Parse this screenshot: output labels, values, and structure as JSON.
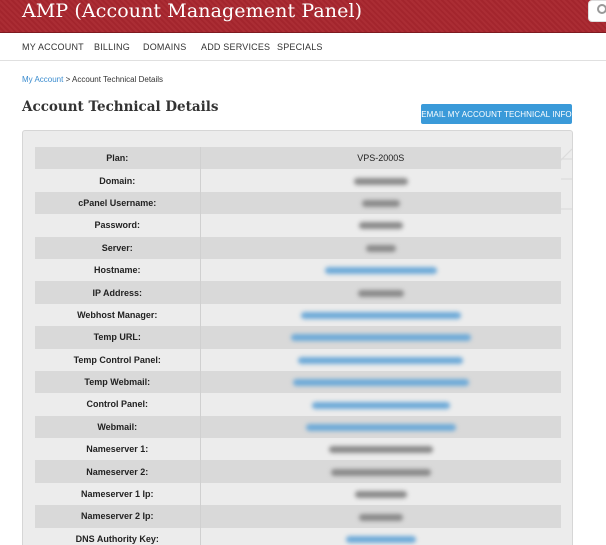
{
  "header": {
    "title": "AMP (Account Management Panel)",
    "brand_color": "#a8262e"
  },
  "nav": {
    "items": [
      "MY ACCOUNT",
      "BILLING",
      "DOMAINS",
      "ADD SERVICES",
      "SPECIALS"
    ]
  },
  "breadcrumb": {
    "link": "My Account",
    "separator": " > ",
    "current": "Account Technical Details"
  },
  "page": {
    "title": "Account Technical Details",
    "email_button": "EMAIL MY ACCOUNT TECHNICAL INFO",
    "accent_color": "#3a9ad9"
  },
  "details": {
    "rows": [
      {
        "label": "Plan:",
        "value": "VPS-2000S",
        "redacted": false,
        "link": false
      },
      {
        "label": "Domain:",
        "value": "",
        "redacted": true,
        "link": false
      },
      {
        "label": "cPanel Username:",
        "value": "",
        "redacted": true,
        "link": false
      },
      {
        "label": "Password:",
        "value": "",
        "redacted": true,
        "link": false
      },
      {
        "label": "Server:",
        "value": "",
        "redacted": true,
        "link": false
      },
      {
        "label": "Hostname:",
        "value": "",
        "redacted": true,
        "link": true
      },
      {
        "label": "IP Address:",
        "value": "",
        "redacted": true,
        "link": false
      },
      {
        "label": "Webhost Manager:",
        "value": "",
        "redacted": true,
        "link": true
      },
      {
        "label": "Temp URL:",
        "value": "",
        "redacted": true,
        "link": true
      },
      {
        "label": "Temp Control Panel:",
        "value": "",
        "redacted": true,
        "link": true
      },
      {
        "label": "Temp Webmail:",
        "value": "",
        "redacted": true,
        "link": true
      },
      {
        "label": "Control Panel:",
        "value": "",
        "redacted": true,
        "link": true
      },
      {
        "label": "Webmail:",
        "value": "",
        "redacted": true,
        "link": true
      },
      {
        "label": "Nameserver 1:",
        "value": "",
        "redacted": true,
        "link": false
      },
      {
        "label": "Nameserver 2:",
        "value": "",
        "redacted": true,
        "link": false
      },
      {
        "label": "Nameserver 1 Ip:",
        "value": "",
        "redacted": true,
        "link": false
      },
      {
        "label": "Nameserver 2 Ip:",
        "value": "",
        "redacted": true,
        "link": false
      },
      {
        "label": "DNS Authority Key:",
        "value": "",
        "redacted": true,
        "link": true
      }
    ]
  }
}
